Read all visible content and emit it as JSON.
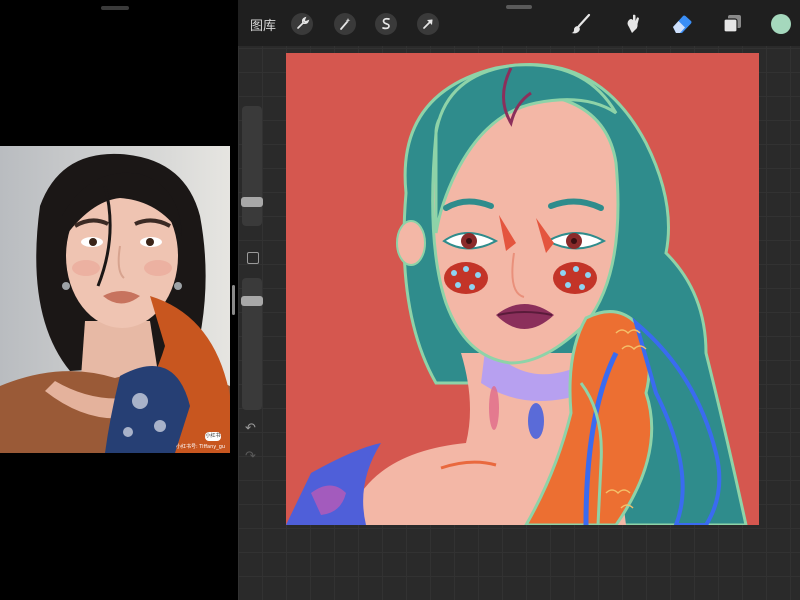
{
  "reference": {
    "watermark_badge": "小红书",
    "watermark_text": "小红书号: Tiffany_gu"
  },
  "toolbar": {
    "gallery_label": "图库",
    "icons": [
      "wrench-icon",
      "magic-wand-icon",
      "selection-icon",
      "transform-arrow-icon"
    ],
    "right_icons": [
      "brush-icon",
      "smudge-icon",
      "eraser-icon",
      "layers-icon"
    ],
    "active_tool": "eraser-icon",
    "current_color": "#a5d8bd"
  },
  "sidebar": {
    "brush_size": 0.17,
    "opacity": 0.85
  },
  "colors": {
    "canvas_bg": "#d5574f",
    "accent": "#3a8ef6"
  }
}
